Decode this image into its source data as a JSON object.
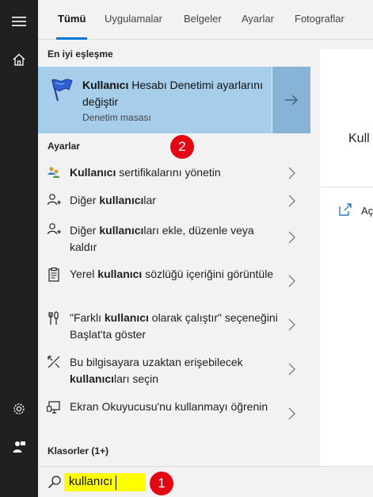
{
  "rail": {
    "items": [
      {
        "icon": "hamburger-menu-icon"
      },
      {
        "icon": "home-icon"
      },
      {
        "icon": "gear-icon"
      },
      {
        "icon": "user-feedback-icon"
      }
    ]
  },
  "tabs": [
    {
      "label": "Tümü",
      "active": true
    },
    {
      "label": "Uygulamalar",
      "active": false
    },
    {
      "label": "Belgeler",
      "active": false
    },
    {
      "label": "Ayarlar",
      "active": false
    },
    {
      "label": "Fotograflar",
      "active": false
    }
  ],
  "best_match": {
    "heading": "En iyi eşleşme",
    "title_bold": "Kullanıcı",
    "title_rest": " Hesabı Denetimi ayarlarını değiştir",
    "subtitle": "Denetim masası",
    "icon": "uac-flag-icon"
  },
  "settings": {
    "heading": "Ayarlar",
    "items": [
      {
        "icon": "certificate-users-icon",
        "parts": [
          {
            "b": true,
            "t": "Kullanıcı"
          },
          {
            "b": false,
            "t": " sertifikalarını yönetin"
          }
        ]
      },
      {
        "icon": "person-add-icon",
        "parts": [
          {
            "b": false,
            "t": "Diğer "
          },
          {
            "b": true,
            "t": "kullanıcı"
          },
          {
            "b": false,
            "t": "lar"
          }
        ]
      },
      {
        "icon": "person-add-icon",
        "parts": [
          {
            "b": false,
            "t": "Diğer "
          },
          {
            "b": true,
            "t": "kullanıcı"
          },
          {
            "b": false,
            "t": "ları ekle, düzenle veya kaldır"
          }
        ]
      },
      {
        "icon": "dictionary-icon",
        "parts": [
          {
            "b": false,
            "t": "Yerel "
          },
          {
            "b": true,
            "t": "kullanıcı"
          },
          {
            "b": false,
            "t": " sözlüğü içeriğini görüntüle"
          }
        ]
      },
      {
        "icon": "tools-icon",
        "parts": [
          {
            "b": false,
            "t": "\"Farklı "
          },
          {
            "b": true,
            "t": "kullanıcı"
          },
          {
            "b": false,
            "t": " olarak çalıştır\" seçeneğini Başlat'ta göster"
          }
        ]
      },
      {
        "icon": "remote-access-icon",
        "parts": [
          {
            "b": false,
            "t": "Bu bilgisayara uzaktan erişebilecek "
          },
          {
            "b": true,
            "t": "kullanıcı"
          },
          {
            "b": false,
            "t": "ları seçin"
          }
        ]
      },
      {
        "icon": "narrator-icon",
        "parts": [
          {
            "b": false,
            "t": "Ekran Okuyucusu'nu kullanmayı öğrenin"
          }
        ]
      }
    ]
  },
  "folders": {
    "heading": "Klasorler (1+)"
  },
  "search": {
    "value": "kullanıcı",
    "icon": "search-icon"
  },
  "preview": {
    "title": "Kull",
    "open_label": "Aç",
    "open_icon": "open-icon"
  },
  "badges": {
    "step1": "1",
    "step2": "2"
  },
  "colors": {
    "accent": "#0078d7",
    "best_bg": "#a6cdea",
    "highlight": "#ffff00",
    "badge": "#e30613"
  }
}
